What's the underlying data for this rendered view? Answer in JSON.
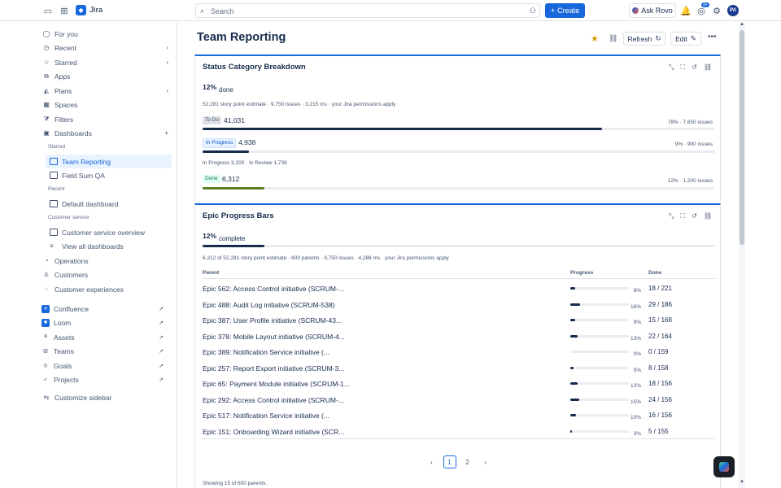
{
  "topbar": {
    "app": "Jira",
    "search_placeholder": "Search",
    "create": "Create",
    "rovo": "Ask Rovo",
    "notif_count": "3+",
    "avatar": "PA"
  },
  "sidebar": {
    "items": [
      {
        "label": "For you",
        "icon": "user-icon"
      },
      {
        "label": "Recent",
        "icon": "clock-icon",
        "chev": "›"
      },
      {
        "label": "Starred",
        "icon": "star-icon",
        "chev": "›"
      },
      {
        "label": "Apps",
        "icon": "apps-icon"
      },
      {
        "label": "Plans",
        "icon": "plans-icon",
        "chev": "›"
      },
      {
        "label": "Spaces",
        "icon": "spaces-icon"
      },
      {
        "label": "Filters",
        "icon": "filter-icon"
      },
      {
        "label": "Dashboards",
        "icon": "dashboard-icon",
        "chev": "+"
      }
    ],
    "starred_head": "Starred",
    "starred": [
      "Team Reporting",
      "Field Sum QA"
    ],
    "recent_head": "Recent",
    "recent": [
      "Default dashboard"
    ],
    "cs_head": "Customer service",
    "cs": [
      "Customer service overview",
      "View all dashboards"
    ],
    "more": [
      "Operations",
      "Customers",
      "Customer experiences"
    ],
    "apps": [
      "Confluence",
      "Loom",
      "Assets",
      "Teams",
      "Goals",
      "Projects"
    ],
    "customize": "Customize sidebar"
  },
  "page": {
    "title": "Team Reporting",
    "refresh": "Refresh",
    "edit": "Edit"
  },
  "status": {
    "title": "Status Category Breakdown",
    "pct": "12%",
    "pct_label": "done",
    "meta": "52,281 story point estimate · 9,750 issues · 3,215 ms · your Jira permissions apply",
    "rows": [
      {
        "lozenge": "To Do",
        "count": "41,031",
        "right": "78% · 7,650 issues",
        "fill": 0.78,
        "color": "#172b4d"
      },
      {
        "lozenge": "In Progress",
        "count": "4,938",
        "right": "9% · 900 issues",
        "fill": 0.09,
        "color": "#172b4d"
      },
      {
        "lozenge": "Done",
        "count": "6,312",
        "right": "12% · 1,200 issues",
        "fill": 0.12,
        "color": "#5b7f24"
      }
    ],
    "sub": "In Progress 3,200 · In Review 1,738"
  },
  "epic": {
    "title": "Epic Progress Bars",
    "pct": "12%",
    "pct_label": "complete",
    "fill": 0.12,
    "meta": "6,312 of 52,281 story point estimate · 600 parents · 9,750 issues · 4,286 ms · your Jira permissions apply",
    "col_parent": "Parent",
    "col_progress": "Progress",
    "col_done": "Done",
    "rows": [
      {
        "name": "Epic 562: Access Control initiative (SCRUM-...",
        "pct": "8%",
        "fill": 0.08,
        "done": "18 / 221"
      },
      {
        "name": "Epic 488: Audit Log initiative (SCRUM-538)",
        "pct": "16%",
        "fill": 0.16,
        "done": "29 / 186"
      },
      {
        "name": "Epic 387: User Profile initiative (SCRUM-43...",
        "pct": "9%",
        "fill": 0.09,
        "done": "15 / 168"
      },
      {
        "name": "Epic 378: Mobile Layout initiative (SCRUM-4...",
        "pct": "13%",
        "fill": 0.13,
        "done": "22 / 164"
      },
      {
        "name": "Epic 389: Notification Service initiative (...",
        "pct": "0%",
        "fill": 0.0,
        "done": "0 / 159"
      },
      {
        "name": "Epic 257: Report Export initiative (SCRUM-3...",
        "pct": "5%",
        "fill": 0.05,
        "done": "8 / 158"
      },
      {
        "name": "Epic 65: Payment Module initiative (SCRUM-1...",
        "pct": "12%",
        "fill": 0.12,
        "done": "18 / 156"
      },
      {
        "name": "Epic 292: Access Control initiative (SCRUM-...",
        "pct": "15%",
        "fill": 0.15,
        "done": "24 / 156"
      },
      {
        "name": "Epic 517: Notification Service initiative (...",
        "pct": "10%",
        "fill": 0.1,
        "done": "16 / 156"
      },
      {
        "name": "Epic 151: Onboarding Wizard initiative (SCR...",
        "pct": "3%",
        "fill": 0.03,
        "done": "5 / 155"
      }
    ],
    "pages": [
      "1",
      "2"
    ],
    "showing": "Showing 15 of 600 parents."
  }
}
